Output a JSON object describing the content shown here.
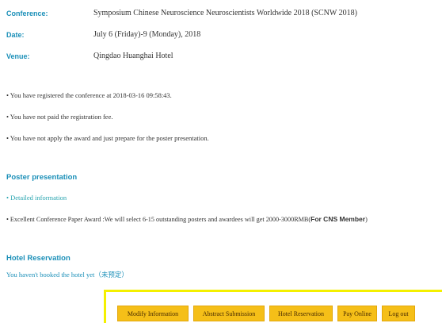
{
  "event_info": {
    "conference_label": "Conference:",
    "conference_value": "Symposium Chinese Neuroscience Neuroscientists Worldwide 2018 (SCNW 2018)",
    "date_label": "Date:",
    "date_value": "July 6 (Friday)-9 (Monday), 2018",
    "venue_label": "Venue:",
    "venue_value": "Qingdao Huanghai Hotel"
  },
  "status": {
    "registered": "• You have registered the conference at 2018-03-16 09:58:43.",
    "payment": "• You have not paid the registration fee.",
    "award": "• You have not apply the award and just prepare for the poster presentation."
  },
  "poster": {
    "title": "Poster presentation",
    "detail_link": "• Detailed information",
    "award_text": "• Excellent Conference Paper Award :We will select 6-15 outstanding posters and awardees will get 2000-3000RMB(",
    "award_bold": "For CNS Member",
    "award_close": ")"
  },
  "hotel": {
    "title": "Hotel Reservation",
    "note": "You haven't booked the hotel yet（未预定）"
  },
  "actions": {
    "modify": "Modify Information",
    "abstract": "Abstract Submission",
    "hotel": "Hotel Reservation",
    "pay": "Pay Online",
    "logout": "Log out"
  },
  "colors": {
    "label_blue": "#1a8fb8",
    "link_teal": "#2aa5b0",
    "button_fill": "#f5bf18",
    "panel_border": "#f4f000"
  }
}
